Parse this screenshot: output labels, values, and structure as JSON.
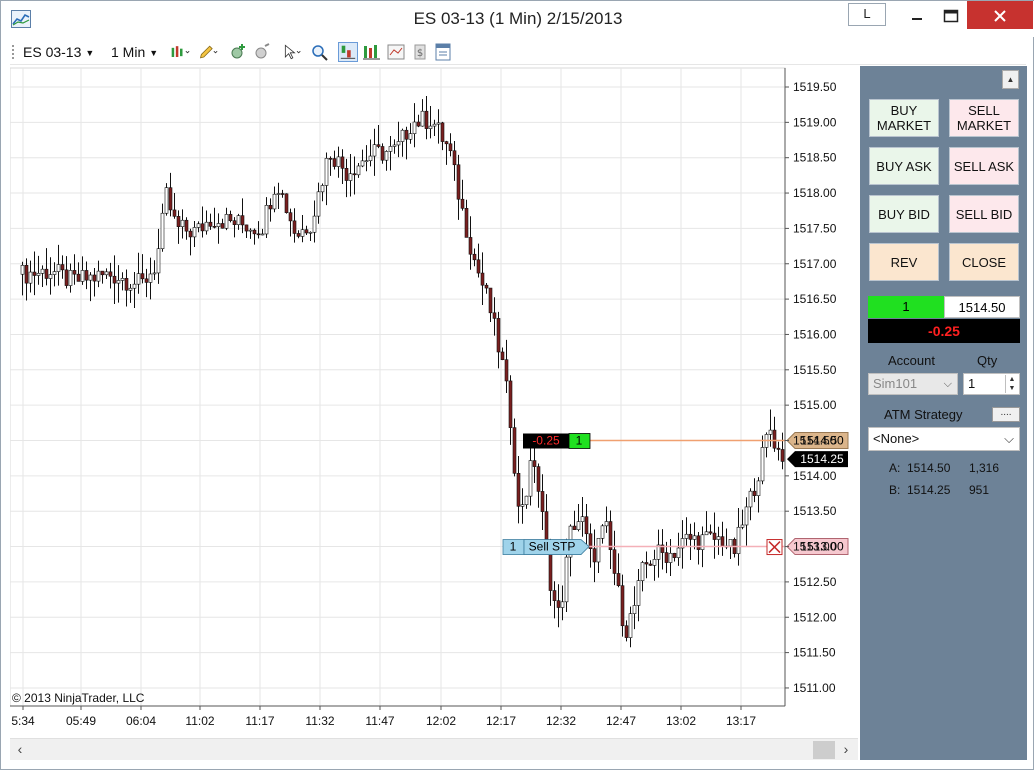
{
  "window": {
    "title": "ES 03-13 (1 Min)  2/15/2013",
    "link_button_label": "L"
  },
  "toolbar": {
    "instrument": "ES 03-13",
    "interval": "1 Min"
  },
  "chart": {
    "copyright": "© 2013 NinjaTrader, LLC",
    "y_axis_labels": [
      "1519.50",
      "1519.00",
      "1518.50",
      "1518.00",
      "1517.50",
      "1517.00",
      "1516.50",
      "1516.00",
      "1515.50",
      "1515.00",
      "1514.50",
      "1514.00",
      "1513.50",
      "1513.00",
      "1512.50",
      "1512.00",
      "1511.50",
      "1511.00"
    ],
    "x_axis_labels": [
      "5:34",
      "05:49",
      "06:04",
      "11:02",
      "11:17",
      "11:32",
      "11:47",
      "12:02",
      "12:17",
      "12:32",
      "12:47",
      "13:02",
      "13:17"
    ],
    "position_marker": {
      "pnl": "-0.25",
      "qty": "1",
      "price_label": "1514.50"
    },
    "last_price_label": "1514.25",
    "stop_order": {
      "qty": "1",
      "label": "Sell STP",
      "price_label": "1513.00"
    },
    "colors": {
      "up_bar": "#ffffff",
      "down_bar": "#7a1f1f",
      "position_line": "#f0a070",
      "stop_line": "#f4b0b8"
    }
  },
  "order_panel": {
    "buttons": {
      "buy_market": "BUY MARKET",
      "sell_market": "SELL MARKET",
      "buy_ask": "BUY ASK",
      "sell_ask": "SELL ASK",
      "buy_bid": "BUY BID",
      "sell_bid": "SELL BID",
      "rev": "REV",
      "close": "CLOSE"
    },
    "position": {
      "qty": "1",
      "avg_price": "1514.50",
      "pnl": "-0.25"
    },
    "account_label": "Account",
    "qty_label": "Qty",
    "account_value": "Sim101",
    "qty_value": "1",
    "atm_label": "ATM Strategy",
    "atm_button_label": "....",
    "atm_value": "<None>",
    "ask_label": "A:",
    "ask_price": "1514.50",
    "ask_size": "1,316",
    "bid_label": "B:",
    "bid_price": "1514.25",
    "bid_size": "951"
  }
}
